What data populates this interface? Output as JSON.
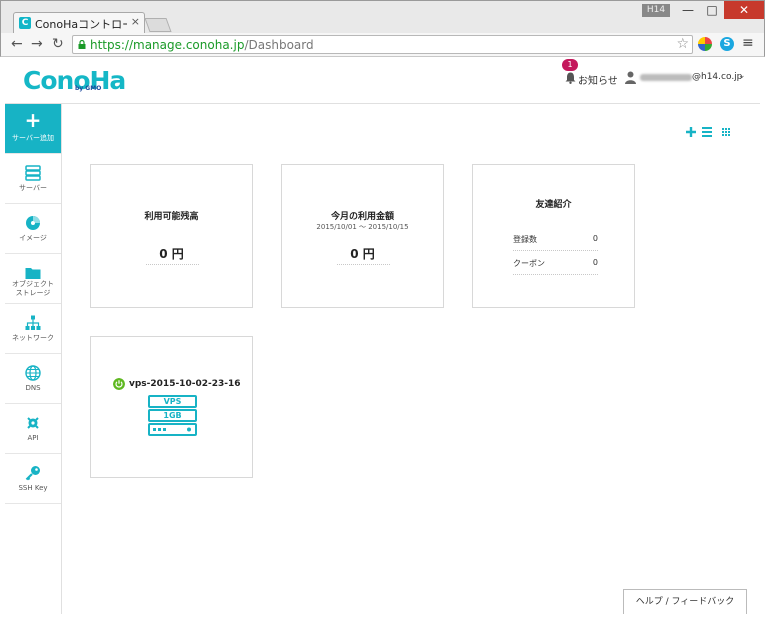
{
  "browser": {
    "tab_title": "ConoHaコントロールパ",
    "tab_favicon": "C",
    "tab_close": "×",
    "user_badge": "H14",
    "url_host": "https://manage.conoha.jp",
    "url_path": "/Dashboard",
    "icons": [
      "back-icon",
      "forward-icon",
      "reload-icon",
      "lock-icon",
      "star-icon",
      "skype-icon",
      "menu-icon"
    ]
  },
  "header": {
    "logo": "ConoHa",
    "logo_sub": "by GMO",
    "notification_count": "1",
    "notification_label": "お知らせ",
    "user_email_suffix": "@h14.co.jp"
  },
  "sidebar": {
    "items": [
      {
        "label": "サーバー追加",
        "icon": "plus-icon"
      },
      {
        "label": "サーバー",
        "icon": "server-icon"
      },
      {
        "label": "イメージ",
        "icon": "disc-icon"
      },
      {
        "label": "オブジェクト\nストレージ",
        "icon": "folder-icon"
      },
      {
        "label": "ネットワーク",
        "icon": "network-icon"
      },
      {
        "label": "DNS",
        "icon": "globe-icon"
      },
      {
        "label": "API",
        "icon": "api-icon"
      },
      {
        "label": "SSH Key",
        "icon": "key-icon"
      }
    ]
  },
  "dashboard": {
    "balance": {
      "title": "利用可能残高",
      "value": "0 円"
    },
    "monthly": {
      "title": "今月の利用金額",
      "period": "2015/10/01 〜 2015/10/15",
      "value": "0 円"
    },
    "referral": {
      "title": "友達紹介",
      "rows": [
        {
          "label": "登録数",
          "value": "0"
        },
        {
          "label": "クーポン",
          "value": "0"
        }
      ]
    },
    "server": {
      "name": "vps-2015-10-02-23-16",
      "type": "VPS",
      "memory": "1GB",
      "status": "running"
    }
  },
  "help_button": "ヘルプ / フィードバック",
  "colors": {
    "accent": "#17b3c5",
    "badge": "#c4185c",
    "running": "#5fb821"
  }
}
